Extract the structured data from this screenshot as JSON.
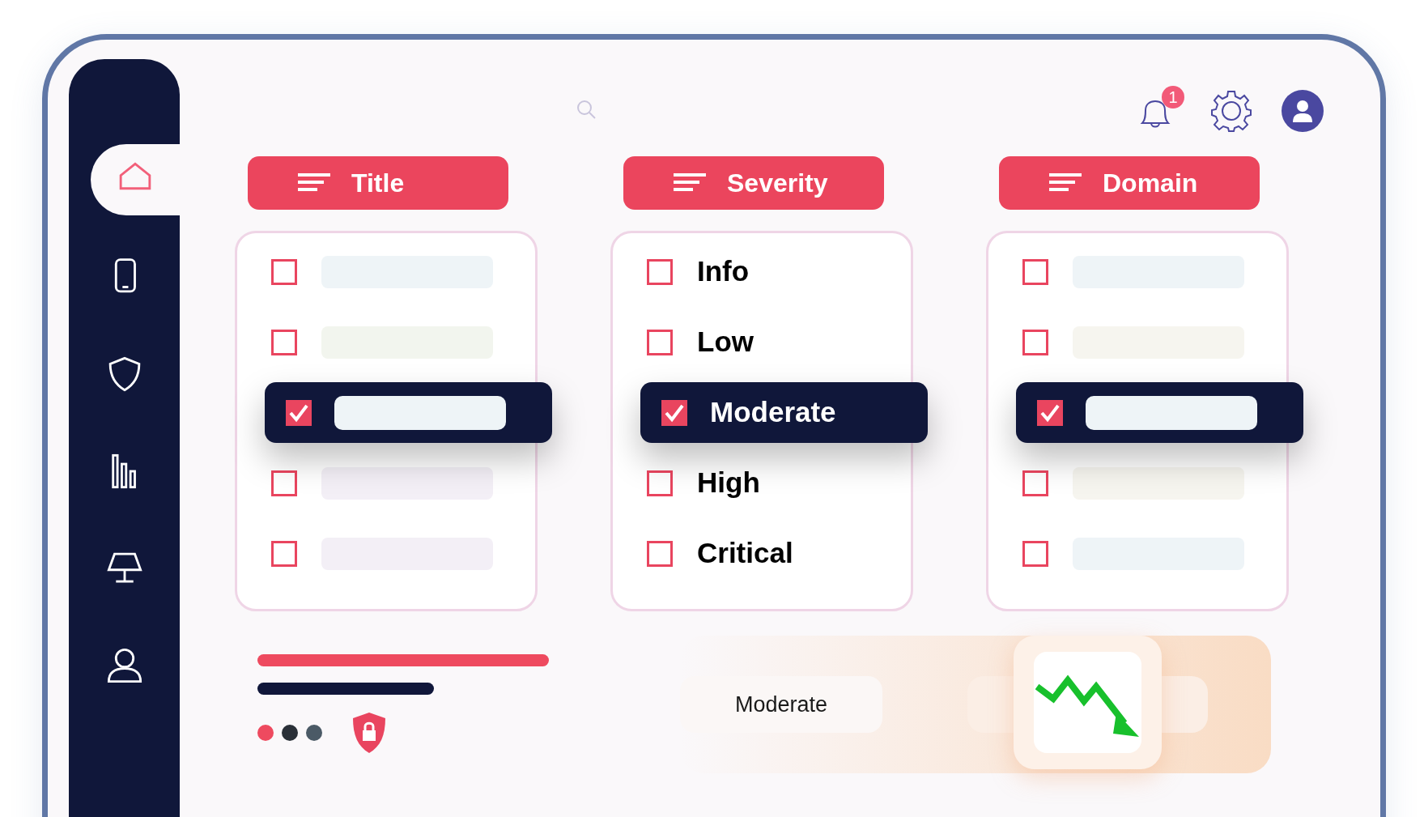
{
  "sidebar": {
    "items": [
      {
        "selected": true
      },
      {
        "selected": false
      },
      {
        "selected": false
      },
      {
        "selected": false
      },
      {
        "selected": false
      },
      {
        "selected": false
      }
    ]
  },
  "header": {
    "notification_count": "1"
  },
  "columns": [
    {
      "title": "Title",
      "rows": [
        {
          "kind": "bar",
          "color": "#eef4f7",
          "checked": false
        },
        {
          "kind": "bar",
          "color": "#f2f5ee",
          "checked": false
        },
        {
          "kind": "bar",
          "color": "#eef4f7",
          "checked": true
        },
        {
          "kind": "bar",
          "color": "#f3eff6",
          "checked": false
        },
        {
          "kind": "bar",
          "color": "#f3eff6",
          "checked": false
        }
      ]
    },
    {
      "title": "Severity",
      "rows": [
        {
          "kind": "label",
          "label": "Info",
          "checked": false
        },
        {
          "kind": "label",
          "label": "Low",
          "checked": false
        },
        {
          "kind": "label",
          "label": "Moderate",
          "checked": true
        },
        {
          "kind": "label",
          "label": "High",
          "checked": false
        },
        {
          "kind": "label",
          "label": "Critical",
          "checked": false
        }
      ]
    },
    {
      "title": "Domain",
      "rows": [
        {
          "kind": "bar",
          "color": "#eef4f7",
          "checked": false
        },
        {
          "kind": "bar",
          "color": "#f6f5ef",
          "checked": false
        },
        {
          "kind": "bar",
          "color": "#eef4f7",
          "checked": true
        },
        {
          "kind": "bar",
          "color": "#f6f5ef",
          "checked": false
        },
        {
          "kind": "bar",
          "color": "#eef4f7",
          "checked": false
        }
      ]
    }
  ],
  "summary": {
    "status": "Moderate",
    "dots": [
      {
        "color": "#ee4a5f"
      },
      {
        "color": "#2a3038"
      },
      {
        "color": "#4b5a66"
      }
    ]
  }
}
